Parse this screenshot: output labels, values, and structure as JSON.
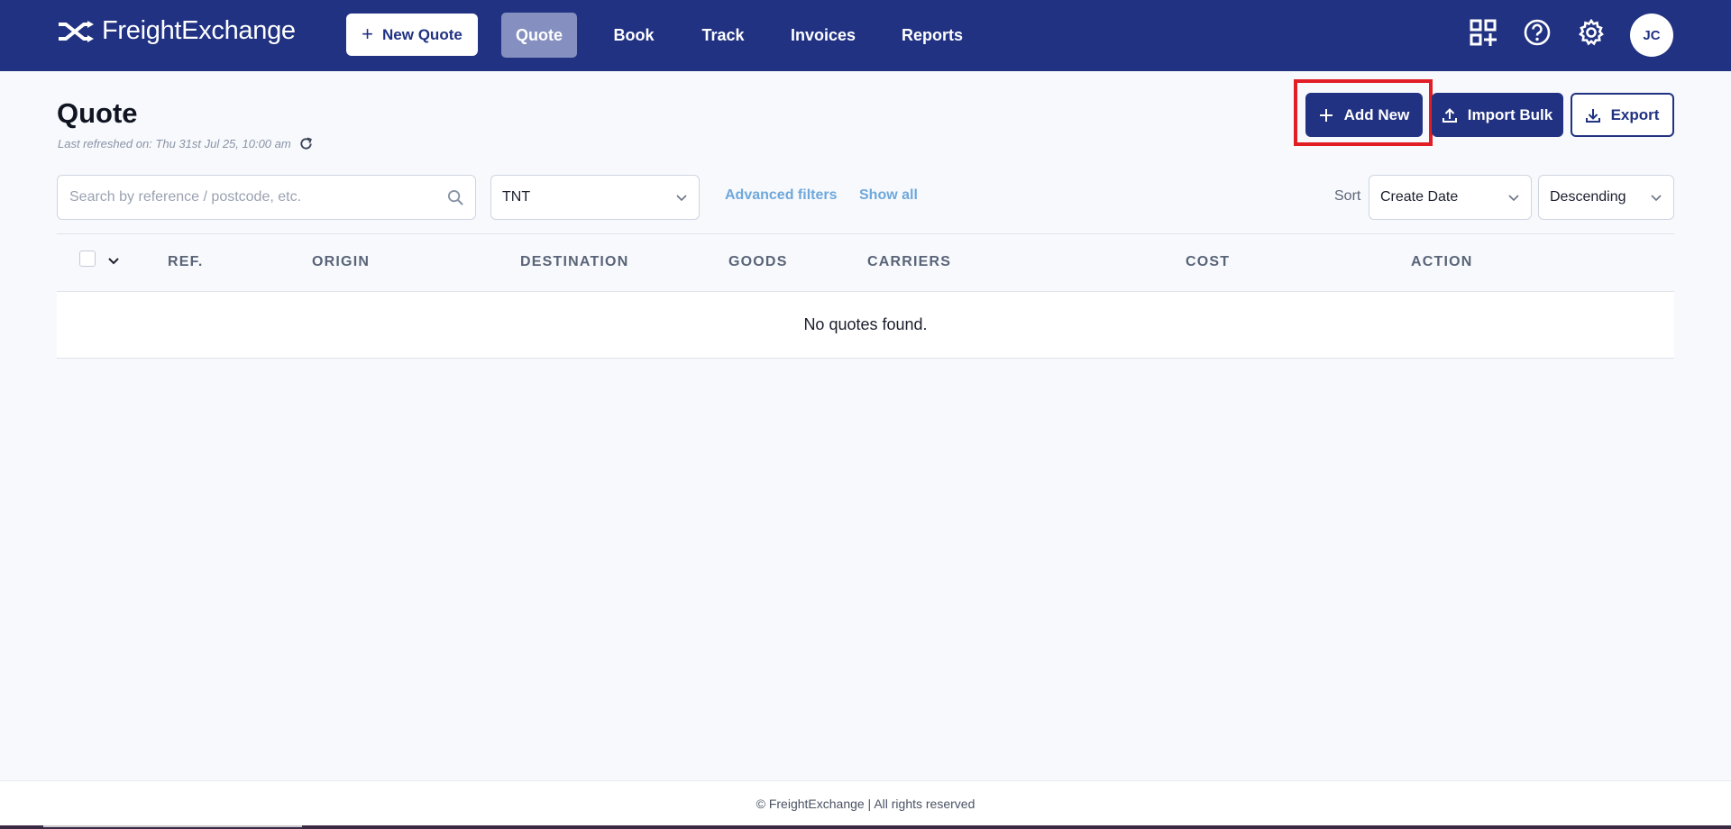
{
  "app": {
    "brand": "FreightExchange"
  },
  "nav": {
    "new_quote_label": "New Quote",
    "links": [
      {
        "label": "Quote",
        "active": true
      },
      {
        "label": "Book",
        "active": false
      },
      {
        "label": "Track",
        "active": false
      },
      {
        "label": "Invoices",
        "active": false
      },
      {
        "label": "Reports",
        "active": false
      }
    ],
    "icons": [
      "apps-add-icon",
      "help-icon",
      "gear-icon"
    ],
    "avatar_initials": "JC"
  },
  "header": {
    "title": "Quote",
    "last_refreshed": "Last refreshed on: Thu 31st Jul 25, 10:00 am",
    "buttons": {
      "add_new": "Add New",
      "import_bulk": "Import Bulk",
      "export": "Export"
    }
  },
  "filters": {
    "search_placeholder": "Search by reference / postcode, etc.",
    "search_value": "",
    "carrier_selected": "TNT",
    "advanced_filters_label": "Advanced filters",
    "show_all_label": "Show all",
    "sort_label": "Sort",
    "sort_field_selected": "Create Date",
    "sort_order_selected": "Descending"
  },
  "table": {
    "columns": [
      "REF.",
      "ORIGIN",
      "DESTINATION",
      "GOODS",
      "CARRIERS",
      "COST",
      "ACTION"
    ],
    "rows": [],
    "empty_message": "No quotes found."
  },
  "footer": {
    "text": "© FreightExchange | All rights reserved"
  },
  "colors": {
    "brand_navy": "#213282",
    "active_nav": "#8590c0",
    "link_blue": "#6ea8dc",
    "highlight_red": "#e11d26"
  }
}
